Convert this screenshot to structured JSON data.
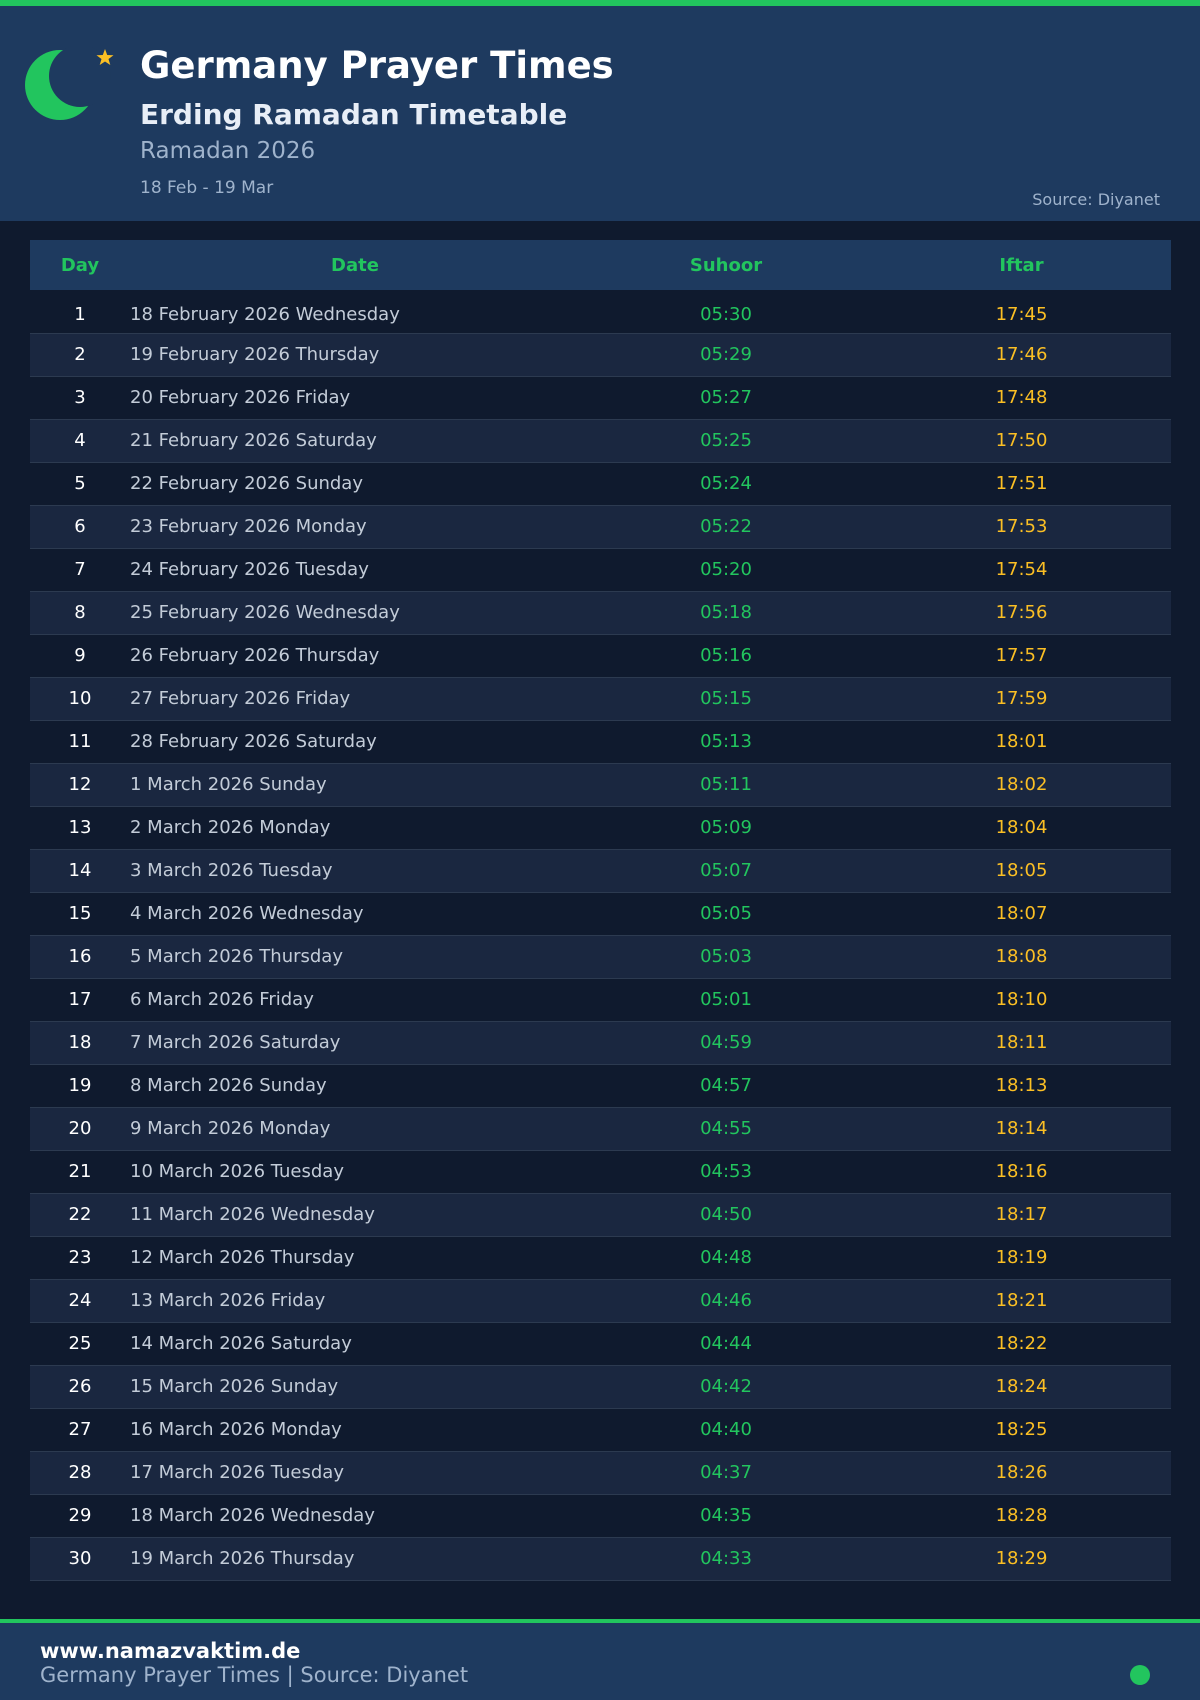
{
  "header": {
    "title": "Germany Prayer Times",
    "subtitle": "Erding Ramadan Timetable",
    "ramadan": "Ramadan 2026",
    "range": "18 Feb - 19 Mar",
    "source": "Source: Diyanet",
    "icon": "crescent-moon-star-icon"
  },
  "colors": {
    "accent": "#22c55e",
    "iftar": "#fbbf24",
    "header_bg": "#1e3a5f",
    "page_bg": "#0f1a2e"
  },
  "table": {
    "columns": [
      "Day",
      "Date",
      "Suhoor",
      "Iftar"
    ],
    "rows": [
      {
        "day": "1",
        "date": "18 February 2026 Wednesday",
        "suhoor": "05:30",
        "iftar": "17:45"
      },
      {
        "day": "2",
        "date": "19 February 2026 Thursday",
        "suhoor": "05:29",
        "iftar": "17:46"
      },
      {
        "day": "3",
        "date": "20 February 2026 Friday",
        "suhoor": "05:27",
        "iftar": "17:48"
      },
      {
        "day": "4",
        "date": "21 February 2026 Saturday",
        "suhoor": "05:25",
        "iftar": "17:50"
      },
      {
        "day": "5",
        "date": "22 February 2026 Sunday",
        "suhoor": "05:24",
        "iftar": "17:51"
      },
      {
        "day": "6",
        "date": "23 February 2026 Monday",
        "suhoor": "05:22",
        "iftar": "17:53"
      },
      {
        "day": "7",
        "date": "24 February 2026 Tuesday",
        "suhoor": "05:20",
        "iftar": "17:54"
      },
      {
        "day": "8",
        "date": "25 February 2026 Wednesday",
        "suhoor": "05:18",
        "iftar": "17:56"
      },
      {
        "day": "9",
        "date": "26 February 2026 Thursday",
        "suhoor": "05:16",
        "iftar": "17:57"
      },
      {
        "day": "10",
        "date": "27 February 2026 Friday",
        "suhoor": "05:15",
        "iftar": "17:59"
      },
      {
        "day": "11",
        "date": "28 February 2026 Saturday",
        "suhoor": "05:13",
        "iftar": "18:01"
      },
      {
        "day": "12",
        "date": "1 March 2026 Sunday",
        "suhoor": "05:11",
        "iftar": "18:02"
      },
      {
        "day": "13",
        "date": "2 March 2026 Monday",
        "suhoor": "05:09",
        "iftar": "18:04"
      },
      {
        "day": "14",
        "date": "3 March 2026 Tuesday",
        "suhoor": "05:07",
        "iftar": "18:05"
      },
      {
        "day": "15",
        "date": "4 March 2026 Wednesday",
        "suhoor": "05:05",
        "iftar": "18:07"
      },
      {
        "day": "16",
        "date": "5 March 2026 Thursday",
        "suhoor": "05:03",
        "iftar": "18:08"
      },
      {
        "day": "17",
        "date": "6 March 2026 Friday",
        "suhoor": "05:01",
        "iftar": "18:10"
      },
      {
        "day": "18",
        "date": "7 March 2026 Saturday",
        "suhoor": "04:59",
        "iftar": "18:11"
      },
      {
        "day": "19",
        "date": "8 March 2026 Sunday",
        "suhoor": "04:57",
        "iftar": "18:13"
      },
      {
        "day": "20",
        "date": "9 March 2026 Monday",
        "suhoor": "04:55",
        "iftar": "18:14"
      },
      {
        "day": "21",
        "date": "10 March 2026 Tuesday",
        "suhoor": "04:53",
        "iftar": "18:16"
      },
      {
        "day": "22",
        "date": "11 March 2026 Wednesday",
        "suhoor": "04:50",
        "iftar": "18:17"
      },
      {
        "day": "23",
        "date": "12 March 2026 Thursday",
        "suhoor": "04:48",
        "iftar": "18:19"
      },
      {
        "day": "24",
        "date": "13 March 2026 Friday",
        "suhoor": "04:46",
        "iftar": "18:21"
      },
      {
        "day": "25",
        "date": "14 March 2026 Saturday",
        "suhoor": "04:44",
        "iftar": "18:22"
      },
      {
        "day": "26",
        "date": "15 March 2026 Sunday",
        "suhoor": "04:42",
        "iftar": "18:24"
      },
      {
        "day": "27",
        "date": "16 March 2026 Monday",
        "suhoor": "04:40",
        "iftar": "18:25"
      },
      {
        "day": "28",
        "date": "17 March 2026 Tuesday",
        "suhoor": "04:37",
        "iftar": "18:26"
      },
      {
        "day": "29",
        "date": "18 March 2026 Wednesday",
        "suhoor": "04:35",
        "iftar": "18:28"
      },
      {
        "day": "30",
        "date": "19 March 2026 Thursday",
        "suhoor": "04:33",
        "iftar": "18:29"
      }
    ]
  },
  "footer": {
    "site": "www.namazvaktim.de",
    "text": "Germany Prayer Times | Source: Diyanet"
  }
}
